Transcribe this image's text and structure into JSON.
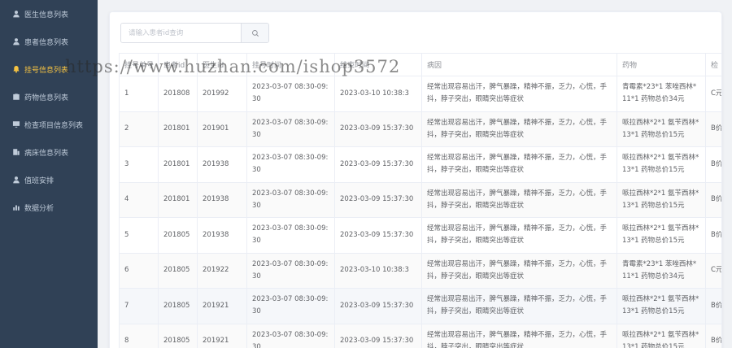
{
  "sidebar": {
    "items": [
      {
        "label": "医生信息列表",
        "icon": "user-icon"
      },
      {
        "label": "患者信息列表",
        "icon": "user-icon"
      },
      {
        "label": "挂号信息列表",
        "icon": "bell-icon",
        "active": true
      },
      {
        "label": "药物信息列表",
        "icon": "briefcase-icon"
      },
      {
        "label": "检查项目信息列表",
        "icon": "monitor-icon"
      },
      {
        "label": "病床信息列表",
        "icon": "office-icon"
      },
      {
        "label": "值班安排",
        "icon": "user-icon"
      },
      {
        "label": "数据分析",
        "icon": "chart-bar-icon"
      }
    ]
  },
  "search": {
    "placeholder": "请输入患者id查询",
    "value": ""
  },
  "table": {
    "columns": [
      "挂号单号",
      "患者id",
      "医生id",
      "挂号时间",
      "结束时间",
      "病因",
      "药物",
      "检"
    ],
    "rows": [
      [
        "1",
        "201808",
        "201992",
        "2023-03-07 08:30-09:30",
        "2023-03-10 10:38:3",
        "经常出现容易出汗，脾气暴躁，精神不振，乏力，心慌，手抖，脖子突出，眼睛突出等症状",
        "青霉素*23*1 苯唑西林*11*1 药物总价34元",
        "C元"
      ],
      [
        "2",
        "201801",
        "201901",
        "2023-03-07 08:30-09:30",
        "2023-03-09 15:37:30",
        "经常出现容易出汗，脾气暴躁，精神不振，乏力，心慌，手抖，脖子突出，眼睛突出等症状",
        "哌拉西林*2*1 氨苄西林*13*1 药物总价15元",
        "B价"
      ],
      [
        "3",
        "201801",
        "201938",
        "2023-03-07 08:30-09:30",
        "2023-03-09 15:37:30",
        "经常出现容易出汗，脾气暴躁，精神不振，乏力，心慌，手抖，脖子突出，眼睛突出等症状",
        "哌拉西林*2*1 氨苄西林*13*1 药物总价15元",
        "B价"
      ],
      [
        "4",
        "201801",
        "201938",
        "2023-03-07 08:30-09:30",
        "2023-03-09 15:37:30",
        "经常出现容易出汗，脾气暴躁，精神不振，乏力，心慌，手抖，脖子突出，眼睛突出等症状",
        "哌拉西林*2*1 氨苄西林*13*1 药物总价15元",
        "B价"
      ],
      [
        "5",
        "201805",
        "201938",
        "2023-03-07 08:30-09:30",
        "2023-03-09 15:37:30",
        "经常出现容易出汗，脾气暴躁，精神不振，乏力，心慌，手抖，脖子突出，眼睛突出等症状",
        "哌拉西林*2*1 氨苄西林*13*1 药物总价15元",
        "B价"
      ],
      [
        "6",
        "201805",
        "201922",
        "2023-03-07 08:30-09:30",
        "2023-03-10 10:38:3",
        "经常出现容易出汗，脾气暴躁，精神不振，乏力，心慌，手抖，脖子突出，眼睛突出等症状",
        "青霉素*23*1 苯唑西林*11*1 药物总价34元",
        "C元"
      ],
      [
        "7",
        "201805",
        "201921",
        "2023-03-07 08:30-09:30",
        "2023-03-09 15:37:30",
        "经常出现容易出汗，脾气暴躁，精神不振，乏力，心慌，手抖，脖子突出，眼睛突出等症状",
        "哌拉西林*2*1 氨苄西林*13*1 药物总价15元",
        "B价"
      ],
      [
        "8",
        "201805",
        "201921",
        "2023-03-07 08:30-09:30",
        "2023-03-09 15:37:30",
        "经常出现容易出汗，脾气暴躁，精神不振，乏力，心慌，手抖，脖子突出，眼睛突出等症状",
        "哌拉西林*2*1 氨苄西林*13*1 药物总价15元",
        "B价"
      ]
    ]
  },
  "watermark": "https://www.huzhan.com/ishop3572",
  "colors": {
    "sidebar_bg": "#304156",
    "sidebar_text": "#bfcbd9",
    "active_text": "#f6c342",
    "page_bg": "#f0f2f5"
  }
}
